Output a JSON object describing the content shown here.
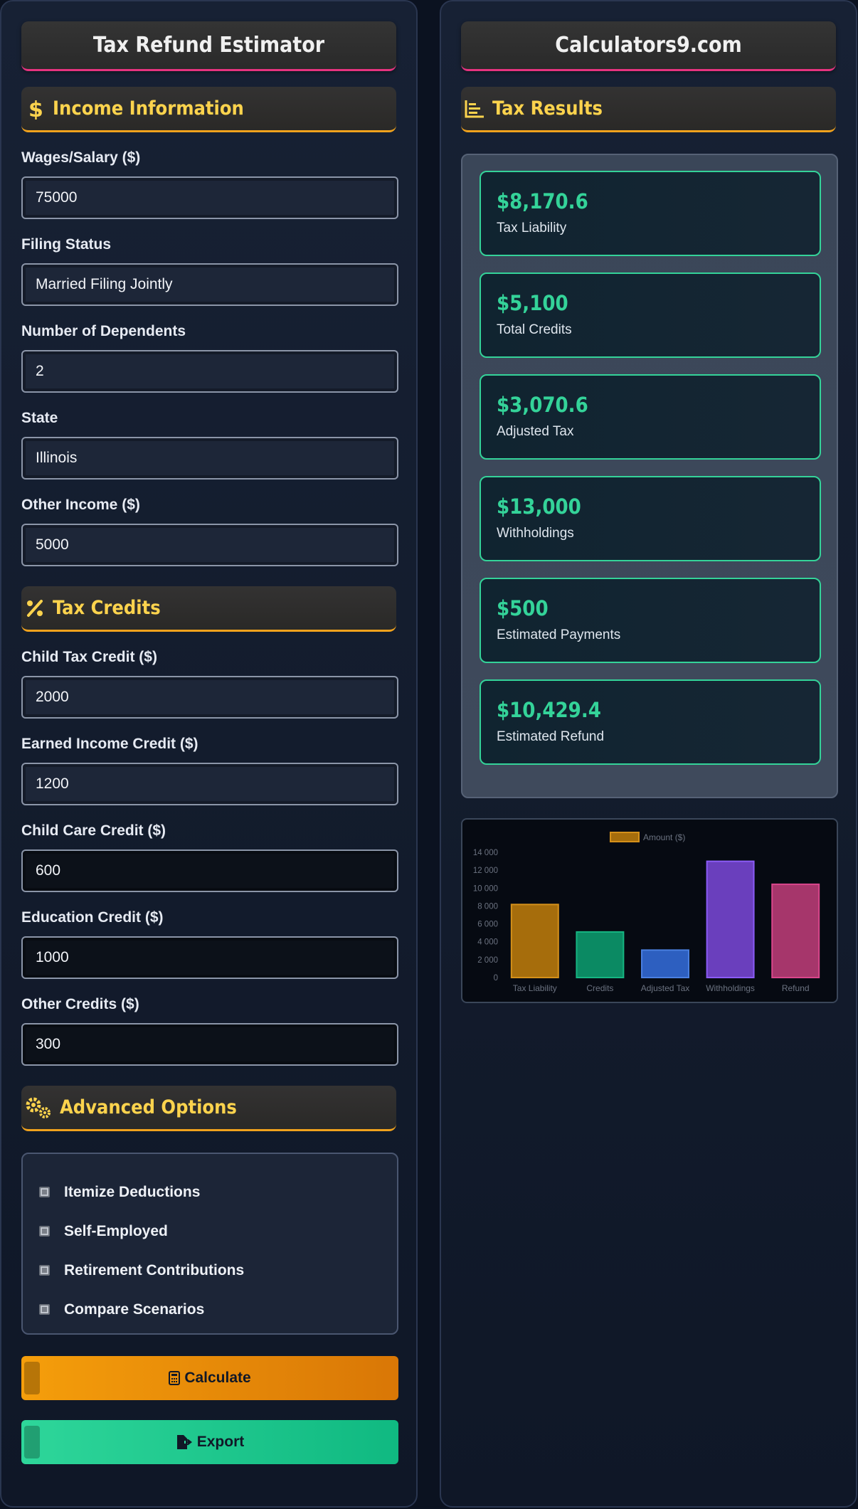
{
  "left": {
    "title": "Tax Refund Estimator",
    "income_section": "Income Information",
    "credits_section": "Tax Credits",
    "advanced_section": "Advanced Options",
    "fields": [
      {
        "label": "Wages/Salary ($)",
        "value": "75000"
      },
      {
        "label": "Filing Status",
        "value": "Married Filing Jointly"
      },
      {
        "label": "Number of Dependents",
        "value": "2"
      },
      {
        "label": "State",
        "value": "Illinois"
      },
      {
        "label": "Other Income ($)",
        "value": "5000"
      }
    ],
    "credit_fields": [
      {
        "label": "Child Tax Credit ($)",
        "value": "2000"
      },
      {
        "label": "Earned Income Credit ($)",
        "value": "1200"
      },
      {
        "label": "Child Care Credit ($)",
        "value": "600"
      },
      {
        "label": "Education Credit ($)",
        "value": "1000"
      },
      {
        "label": "Other Credits ($)",
        "value": "300"
      }
    ],
    "options": [
      "Itemize Deductions",
      "Self-Employed",
      "Retirement Contributions",
      "Compare Scenarios"
    ],
    "calculate_label": "Calculate",
    "export_label": "Export"
  },
  "right": {
    "title": "Calculators9.com",
    "results_section": "Tax Results",
    "cards": [
      {
        "value": "$8,170.6",
        "label": "Tax Liability"
      },
      {
        "value": "$5,100",
        "label": "Total Credits"
      },
      {
        "value": "$3,070.6",
        "label": "Adjusted Tax"
      },
      {
        "value": "$13,000",
        "label": "Withholdings"
      },
      {
        "value": "$500",
        "label": "Estimated Payments"
      },
      {
        "value": "$10,429.4",
        "label": "Estimated Refund"
      }
    ]
  },
  "colors": {
    "accent_yellow": "#fcd34d",
    "accent_green": "#34d399",
    "accent_pink": "#e6337f",
    "accent_orange": "#f0a21d"
  },
  "chart_data": {
    "type": "bar",
    "categories": [
      "Tax Liability",
      "Credits",
      "Adjusted Tax",
      "Withholdings",
      "Refund"
    ],
    "series": [
      {
        "name": "Amount ($)",
        "values": [
          8170.6,
          5100,
          3070.6,
          13000,
          10429.4
        ]
      }
    ],
    "colors": [
      "#a66d0c",
      "#0b8a63",
      "#2d5fc0",
      "#6a3fbd",
      "#a6366b"
    ],
    "border_colors": [
      "#d4901a",
      "#16b582",
      "#4a7fe0",
      "#8b5cf6",
      "#d9468b"
    ],
    "yticks": [
      "0",
      "2 000",
      "4 000",
      "6 000",
      "8 000",
      "10 000",
      "12 000",
      "14 000"
    ],
    "ylim": [
      0,
      14000
    ],
    "legend": "top-center",
    "grid": false
  }
}
